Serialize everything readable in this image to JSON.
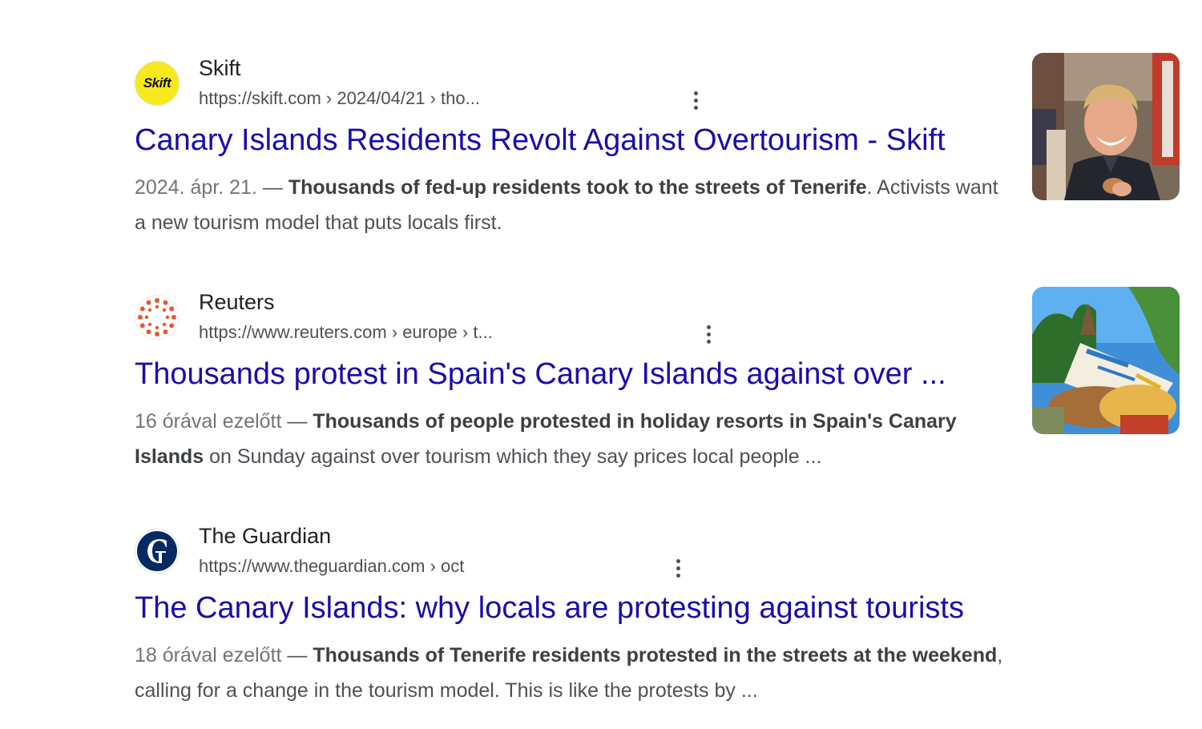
{
  "results": [
    {
      "site_name": "Skift",
      "favicon_text": "Skift",
      "url": "https://skift.com › 2024/04/21 › tho...",
      "title": "Canary Islands Residents Revolt Against Overtourism - Skift",
      "date": "2024. ápr. 21.",
      "separator": " — ",
      "snippet_bold": "Thousands of fed-up residents took to the streets of Tenerife",
      "snippet_rest": ". Activists want a new tourism model that puts locals first.",
      "thumbnail": "smiling-man-photo"
    },
    {
      "site_name": "Reuters",
      "url": "https://www.reuters.com › europe › t...",
      "title": "Thousands protest in Spain's Canary Islands against over ...",
      "date": "16 órával ezelőtt",
      "separator": " — ",
      "snippet_bold": "Thousands of people protested in holiday resorts in Spain's Canary Islands",
      "snippet_rest": " on Sunday against over tourism which they say prices local people ...",
      "thumbnail": "protest-sign-photo"
    },
    {
      "site_name": "The Guardian",
      "url": "https://www.theguardian.com › oct",
      "title": "The Canary Islands: why locals are protesting against tourists",
      "date": "18 órával ezelőtt",
      "separator": " — ",
      "snippet_bold": "Thousands of Tenerife residents protested in the streets at the weekend",
      "snippet_rest": ", calling for a change in the tourism model. This is like the protests by ..."
    }
  ],
  "icons": {
    "more": "more-vert-icon",
    "skift": "skift-logo-icon",
    "reuters": "reuters-logo-icon",
    "guardian": "guardian-logo-icon"
  },
  "colors": {
    "link": "#1a0dab",
    "url": "#4d5156",
    "snippet": "#4d5156",
    "reuters_orange": "#e65a2e",
    "guardian_navy": "#052962",
    "skift_yellow": "#f6ea1c"
  }
}
